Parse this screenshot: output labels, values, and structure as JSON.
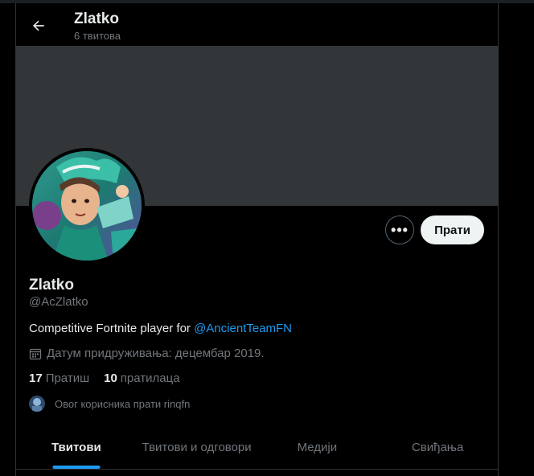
{
  "header": {
    "name": "Zlatko",
    "tweet_count": "6 твитова"
  },
  "profile": {
    "name": "Zlatko",
    "handle": "@AcZlatko",
    "bio_text": "Competitive Fortnite player for ",
    "bio_mention": "@AncientTeamFN",
    "joined": "Датум придруживања: децембар 2019.",
    "following_count": "17",
    "following_label": "Пратиш",
    "followers_count": "10",
    "followers_label": "пратилаца",
    "followed_by": "Овог корисника прати rinqfn"
  },
  "actions": {
    "more_label": "•••",
    "follow_label": "Прати"
  },
  "tabs": [
    {
      "label": "Твитови",
      "active": true
    },
    {
      "label": "Твитови и одговори",
      "active": false
    },
    {
      "label": "Медији",
      "active": false
    },
    {
      "label": "Свиђања",
      "active": false
    }
  ],
  "colors": {
    "accent": "#1d9bf0",
    "banner": "#333639",
    "muted": "#71767b"
  },
  "icons": {
    "back": "arrow-left-icon",
    "joined": "calendar-icon",
    "more": "more-horizontal-icon"
  }
}
